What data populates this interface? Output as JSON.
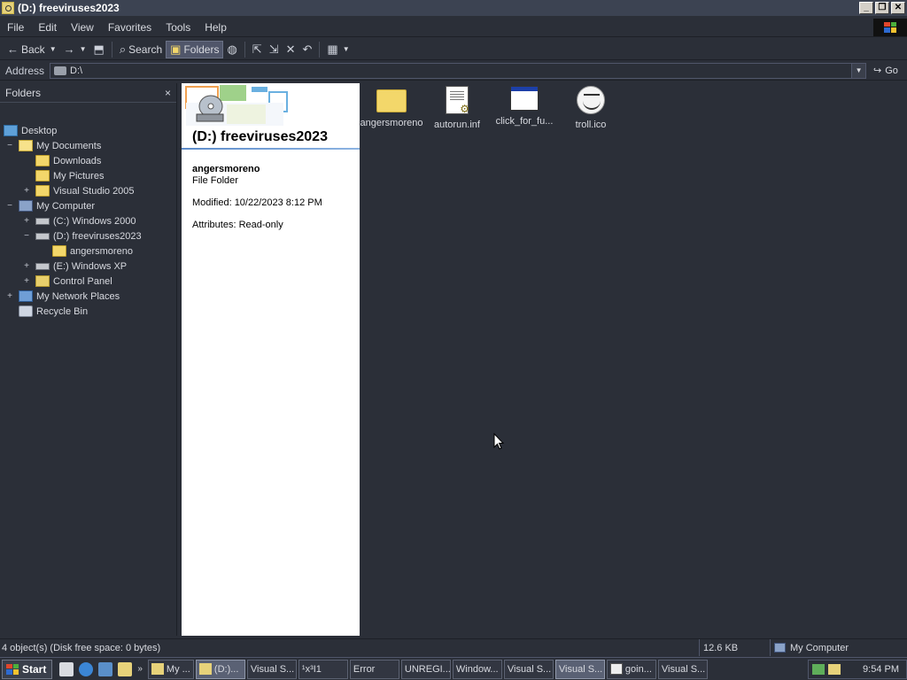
{
  "window": {
    "title": "(D:) freeviruses2023"
  },
  "menu": [
    "File",
    "Edit",
    "View",
    "Favorites",
    "Tools",
    "Help"
  ],
  "toolbar": {
    "back": "Back",
    "search": "Search",
    "folders": "Folders"
  },
  "address": {
    "label": "Address",
    "value": "D:\\",
    "go": "Go"
  },
  "folders_panel": {
    "title": "Folders",
    "close": "×",
    "items": [
      {
        "label": "Desktop",
        "expander": "",
        "icon": "desktop-icon"
      },
      {
        "label": "My Documents",
        "expander": "−",
        "icon": "my-documents-icon"
      },
      {
        "label": "Downloads",
        "expander": "",
        "icon": "folder-icon"
      },
      {
        "label": "My Pictures",
        "expander": "",
        "icon": "folder-icon"
      },
      {
        "label": "Visual Studio 2005",
        "expander": "+",
        "icon": "folder-icon"
      },
      {
        "label": "My Computer",
        "expander": "−",
        "icon": "my-computer-icon"
      },
      {
        "label": "(C:) Windows 2000",
        "expander": "+",
        "icon": "drive-icon"
      },
      {
        "label": "(D:) freeviruses2023",
        "expander": "−",
        "icon": "cd-drive-icon"
      },
      {
        "label": "angersmoreno",
        "expander": "",
        "icon": "folder-icon"
      },
      {
        "label": "(E:) Windows XP",
        "expander": "+",
        "icon": "drive-icon"
      },
      {
        "label": "Control Panel",
        "expander": "+",
        "icon": "control-panel-icon"
      },
      {
        "label": "My Network Places",
        "expander": "+",
        "icon": "network-places-icon"
      },
      {
        "label": "Recycle Bin",
        "expander": "",
        "icon": "recycle-bin-icon"
      }
    ]
  },
  "info": {
    "title": "(D:) freeviruses2023",
    "name": "angersmoreno",
    "type": "File Folder",
    "modified": "Modified: 10/22/2023 8:12 PM",
    "attributes": "Attributes: Read-only"
  },
  "files": [
    {
      "name": "angersmoreno",
      "icon": "folder-icon"
    },
    {
      "name": "autorun.inf",
      "icon": "setup-info-icon"
    },
    {
      "name": "click_for_fu...",
      "icon": "application-window-icon"
    },
    {
      "name": "troll.ico",
      "icon": "troll-face-icon"
    }
  ],
  "status": {
    "objects": "4 object(s) (Disk free space: 0 bytes)",
    "size": "12.6 KB",
    "zone": "My Computer"
  },
  "taskbar": {
    "start": "Start",
    "more": "»",
    "tasks": [
      {
        "label": "My ...",
        "active": false
      },
      {
        "label": "(D:)...",
        "active": true
      },
      {
        "label": "Visual S...",
        "active": false
      },
      {
        "label": "¹x³I1",
        "active": false
      },
      {
        "label": "Error",
        "active": false
      },
      {
        "label": "UNREGI...",
        "active": false
      },
      {
        "label": "Window...",
        "active": false
      },
      {
        "label": "Visual S...",
        "active": false
      },
      {
        "label": "Visual S...",
        "active": true
      },
      {
        "label": "goin...",
        "active": false
      },
      {
        "label": "Visual S...",
        "active": false
      }
    ],
    "clock": "9:54 PM"
  },
  "colors": {
    "background": "#2b2f38",
    "titlebar": "#3c4352",
    "folder": "#f3d76a",
    "selection": "#5a6174"
  }
}
